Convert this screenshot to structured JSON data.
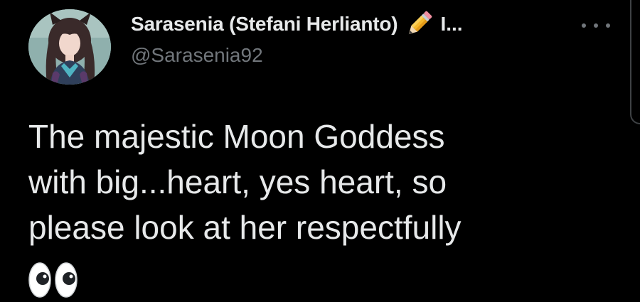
{
  "tweet": {
    "author": {
      "display_name": "Sarasenia (Stefani Herlianto)",
      "name_overflow": "I...",
      "handle": "@Sarasenia92",
      "badge_icon": "pencil-icon",
      "avatar": "avatar-photo"
    },
    "more_icon": "more-options-icon",
    "text": "The majestic Moon Goddess\nwith big...heart, yes heart, so\nplease look at her respectfully",
    "emoji": "eyes-emoji"
  },
  "colors": {
    "background": "#000000",
    "primary_text": "#e7e9ea",
    "secondary_text": "#71767b"
  }
}
